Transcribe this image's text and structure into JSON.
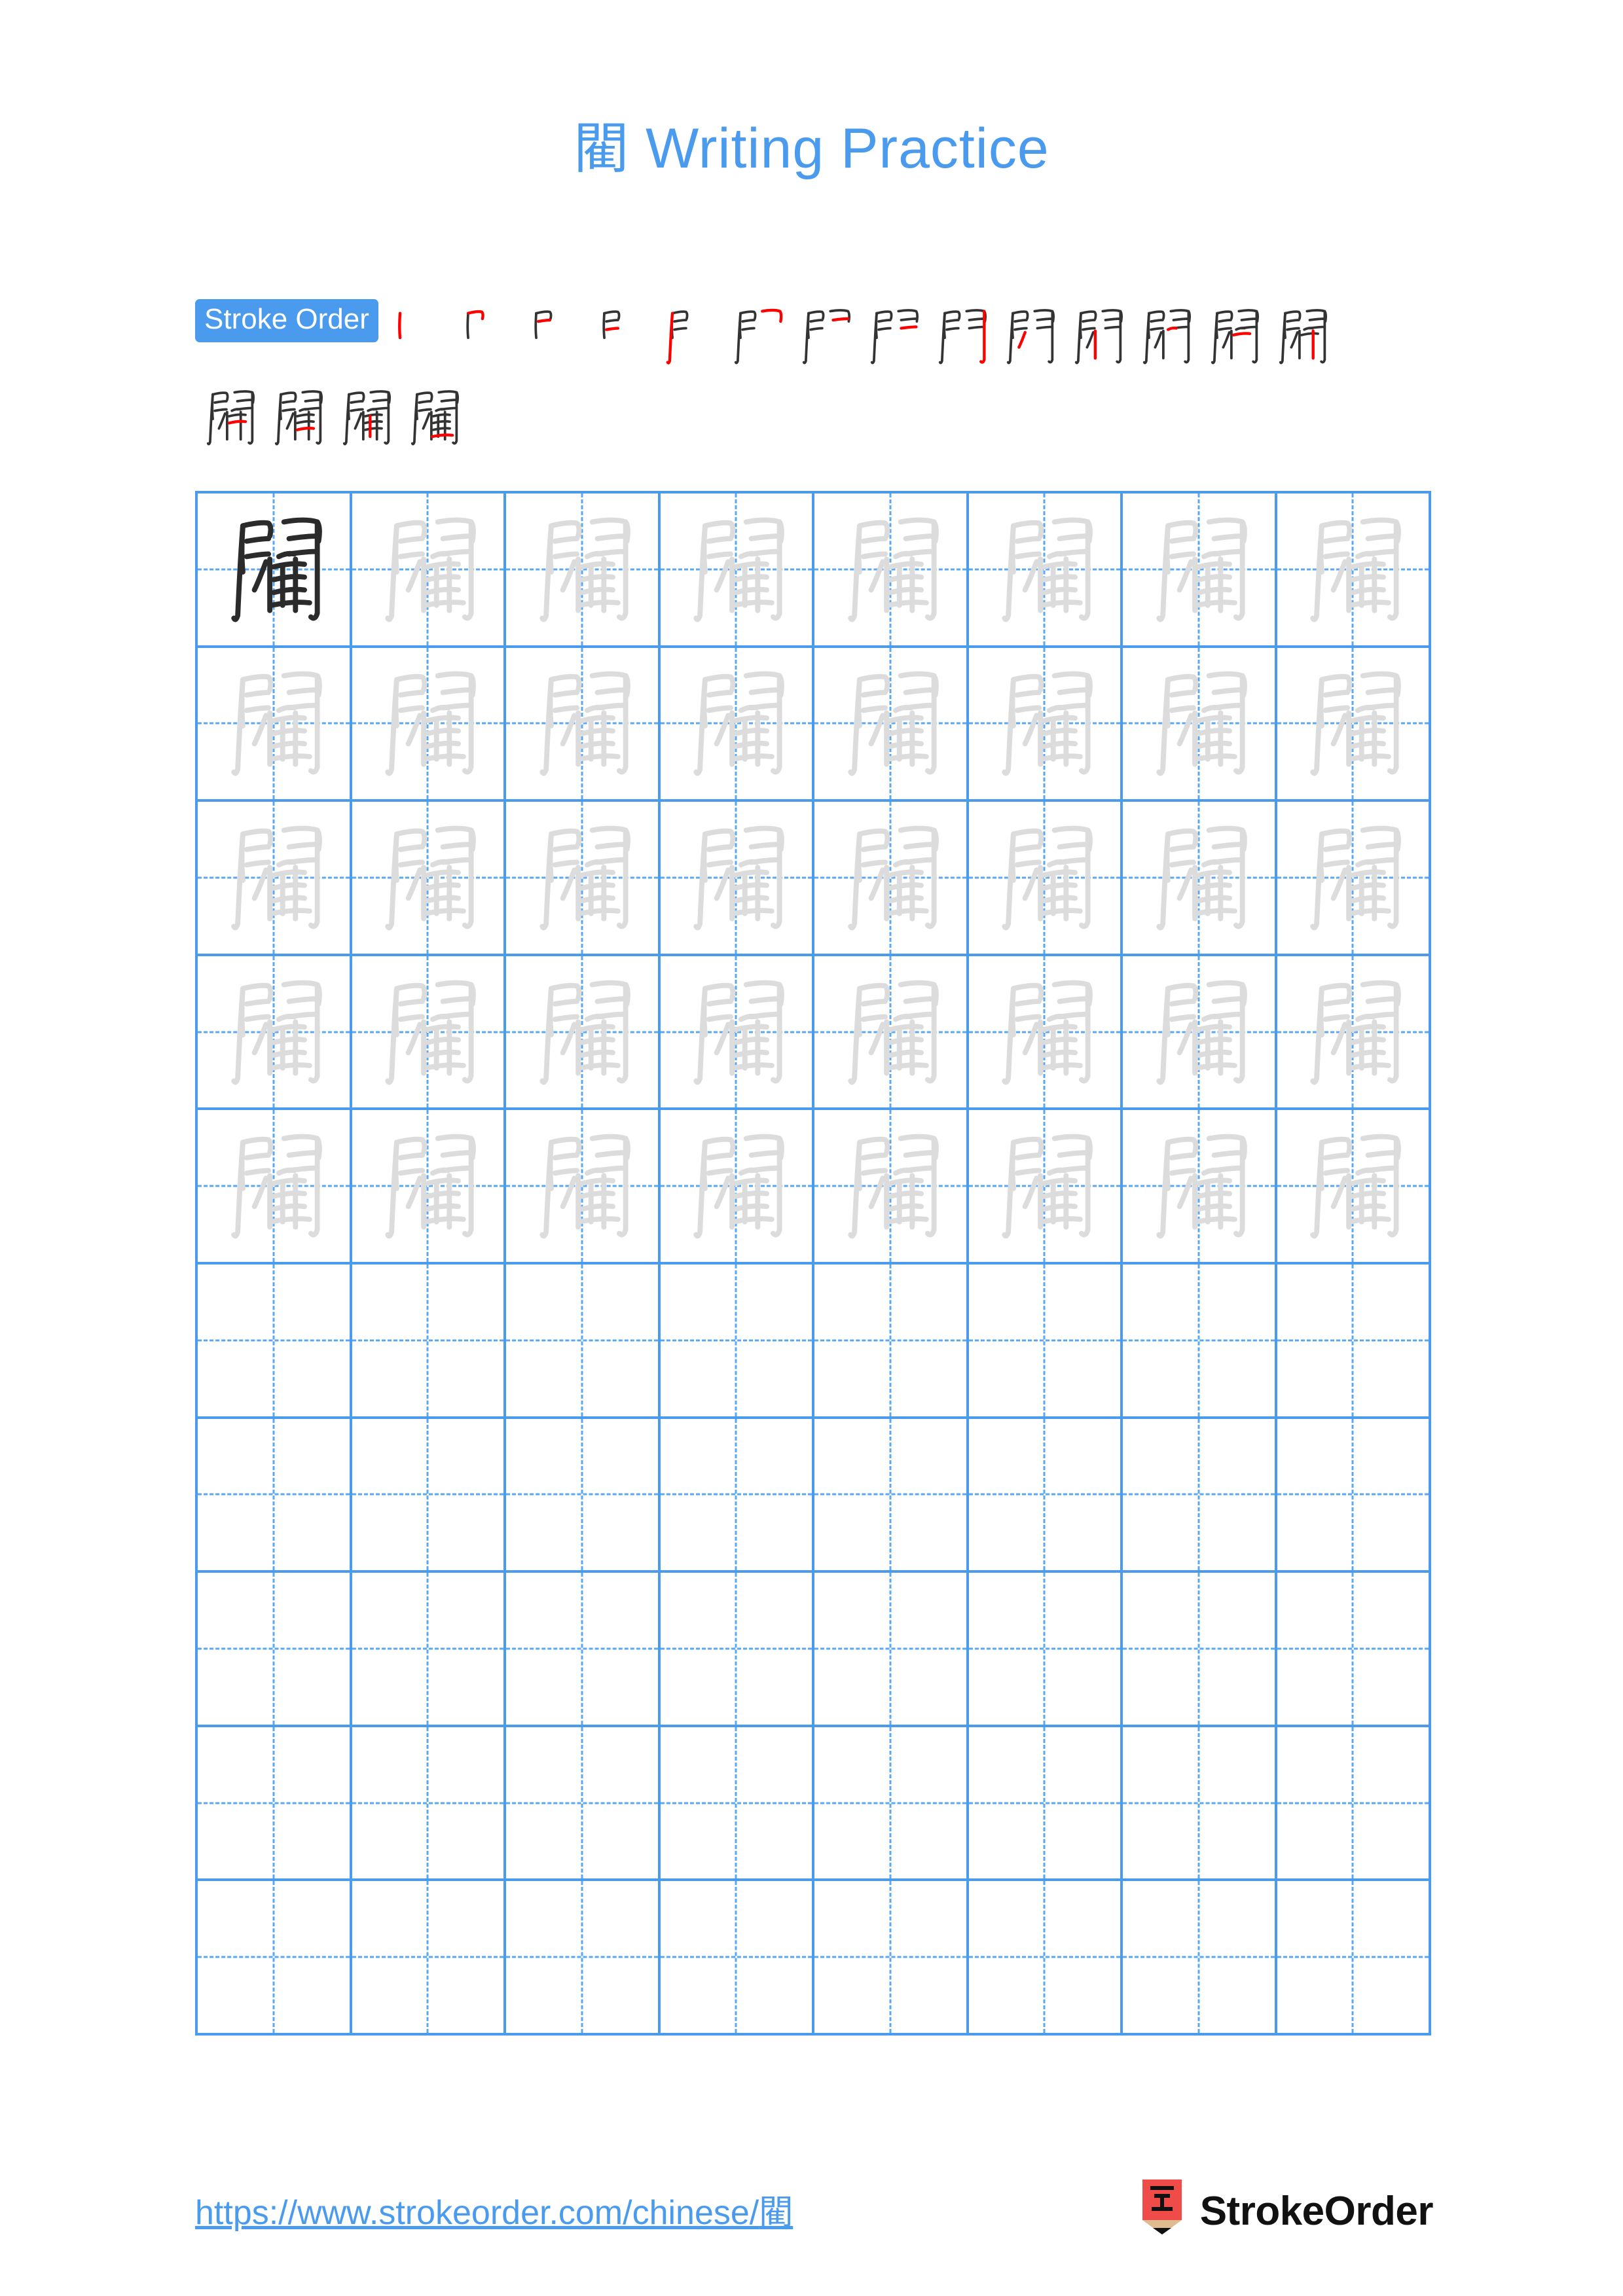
{
  "character": "閵",
  "title": {
    "character": "閵",
    "text": " Writing Practice",
    "full": "閵 Writing Practice",
    "color": "#4a9aee"
  },
  "stroke_order": {
    "badge_label": "Stroke Order",
    "badge_bg": "#4a9aee",
    "badge_text_color": "#ffffff",
    "total_strokes": 18,
    "new_stroke_color": "#ff0000",
    "existing_stroke_color": "#333333",
    "row1_count": 14,
    "row2_count": 4,
    "steps": [
      {
        "index": 1,
        "row": 1
      },
      {
        "index": 2,
        "row": 1
      },
      {
        "index": 3,
        "row": 1
      },
      {
        "index": 4,
        "row": 1
      },
      {
        "index": 5,
        "row": 1
      },
      {
        "index": 6,
        "row": 1
      },
      {
        "index": 7,
        "row": 1
      },
      {
        "index": 8,
        "row": 1
      },
      {
        "index": 9,
        "row": 1
      },
      {
        "index": 10,
        "row": 1
      },
      {
        "index": 11,
        "row": 1
      },
      {
        "index": 12,
        "row": 1
      },
      {
        "index": 13,
        "row": 1
      },
      {
        "index": 14,
        "row": 1
      },
      {
        "index": 15,
        "row": 2
      },
      {
        "index": 16,
        "row": 2
      },
      {
        "index": 17,
        "row": 2
      },
      {
        "index": 18,
        "row": 2
      }
    ]
  },
  "practice_grid": {
    "rows": 10,
    "columns": 8,
    "grid_line_color": "#4a9aee",
    "guide_line_color": "#5aa7f2",
    "model_char_color": "#2b2b2b",
    "trace_char_color": "#dcdcdc",
    "filled_rows": 5,
    "empty_rows": 5,
    "cells": [
      [
        "model",
        "trace",
        "trace",
        "trace",
        "trace",
        "trace",
        "trace",
        "trace"
      ],
      [
        "trace",
        "trace",
        "trace",
        "trace",
        "trace",
        "trace",
        "trace",
        "trace"
      ],
      [
        "trace",
        "trace",
        "trace",
        "trace",
        "trace",
        "trace",
        "trace",
        "trace"
      ],
      [
        "trace",
        "trace",
        "trace",
        "trace",
        "trace",
        "trace",
        "trace",
        "trace"
      ],
      [
        "trace",
        "trace",
        "trace",
        "trace",
        "trace",
        "trace",
        "trace",
        "trace"
      ],
      [
        "empty",
        "empty",
        "empty",
        "empty",
        "empty",
        "empty",
        "empty",
        "empty"
      ],
      [
        "empty",
        "empty",
        "empty",
        "empty",
        "empty",
        "empty",
        "empty",
        "empty"
      ],
      [
        "empty",
        "empty",
        "empty",
        "empty",
        "empty",
        "empty",
        "empty",
        "empty"
      ],
      [
        "empty",
        "empty",
        "empty",
        "empty",
        "empty",
        "empty",
        "empty",
        "empty"
      ],
      [
        "empty",
        "empty",
        "empty",
        "empty",
        "empty",
        "empty",
        "empty",
        "empty"
      ]
    ]
  },
  "footer": {
    "url_prefix": "https://www.strokeorder.com/chinese/",
    "url_character": "閵",
    "url_full": "https://www.strokeorder.com/chinese/閵",
    "url_color": "#4a9aee",
    "brand_name": "StrokeOrder",
    "logo": {
      "icon_character": "字",
      "body_color": "#ef4b49",
      "wood_color": "#e0bb8f",
      "tip_color": "#111111"
    }
  }
}
